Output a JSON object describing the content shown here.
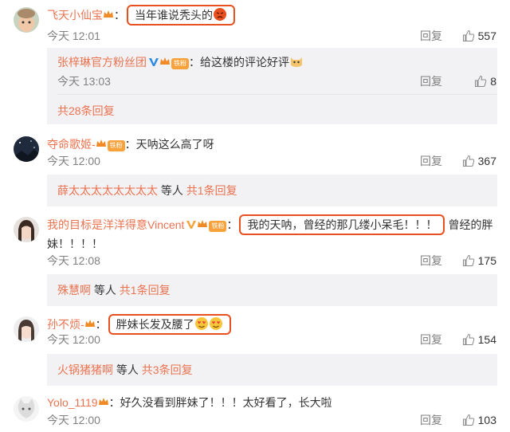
{
  "comments": [
    {
      "username": "飞天小仙宝",
      "text": "当年谁说秃头的",
      "time": "今天 12:01",
      "reply_label": "回复",
      "likes": "557",
      "sub_reply": {
        "username": "张梓琳官方粉丝团",
        "fan_label": "铁粉",
        "colon": "：",
        "text": "给这楼的评论好评",
        "time": "今天 13:03",
        "reply_label": "回复",
        "likes": "8"
      },
      "more_replies": "共28条回复"
    },
    {
      "username": "夺命歌姬-",
      "fan_label": "铁粉",
      "colon": "：",
      "text": "天呐这么高了呀",
      "time": "今天 12:00",
      "reply_label": "回复",
      "likes": "367",
      "reply_summary": {
        "who": "薛太太太太太太太太",
        "mid": "等人",
        "count": "共1条回复"
      }
    },
    {
      "username": "我的目标是洋洋得意Vincent",
      "fan_label": "铁粉",
      "colon": "：",
      "text": "我的天呐，曾经的那几缕小呆毛！！！",
      "text_continued": "曾经的胖",
      "text_line2": "妹！！！！",
      "time": "今天 12:08",
      "reply_label": "回复",
      "likes": "175",
      "reply_summary": {
        "who": "殊慧啊",
        "mid": "等人",
        "count": "共1条回复"
      }
    },
    {
      "username": "孙不烦-",
      "colon": "：",
      "text": "胖妹长发及腰了",
      "time": "今天 12:00",
      "reply_label": "回复",
      "likes": "154",
      "reply_summary": {
        "who": "火锅猪猪啊",
        "mid": "等人",
        "count": "共3条回复"
      }
    },
    {
      "username": "Yolo_1119",
      "colon": "：",
      "text": "好久没看到胖妹了！！！太好看了，长大啦",
      "time": "今天 12:00",
      "reply_label": "回复",
      "likes": "103"
    }
  ],
  "colors": {
    "username": "#eb7350",
    "highlight_border": "#e8501f",
    "muted": "#808080",
    "reply_bg": "#f2f2f5"
  }
}
